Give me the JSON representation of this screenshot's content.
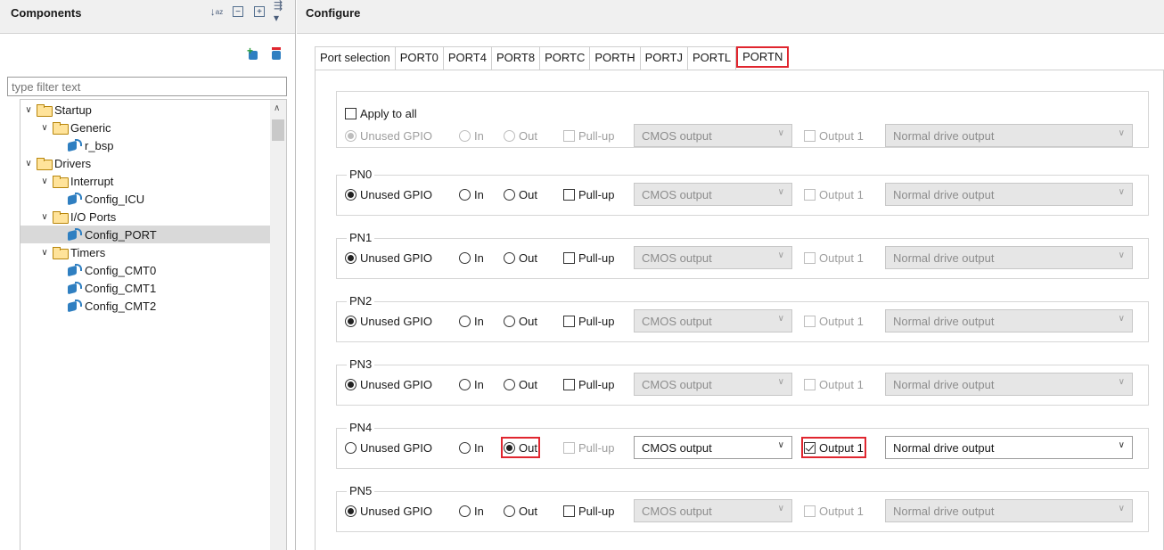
{
  "left_panel": {
    "title": "Components",
    "filter_placeholder": "type filter text",
    "tree": [
      {
        "label": "Startup",
        "depth": 0,
        "kind": "folder"
      },
      {
        "label": "Generic",
        "depth": 1,
        "kind": "folder"
      },
      {
        "label": "r_bsp",
        "depth": 2,
        "kind": "component"
      },
      {
        "label": "Drivers",
        "depth": 0,
        "kind": "folder"
      },
      {
        "label": "Interrupt",
        "depth": 1,
        "kind": "folder"
      },
      {
        "label": "Config_ICU",
        "depth": 2,
        "kind": "component"
      },
      {
        "label": "I/O Ports",
        "depth": 1,
        "kind": "folder"
      },
      {
        "label": "Config_PORT",
        "depth": 2,
        "kind": "component",
        "selected": true
      },
      {
        "label": "Timers",
        "depth": 1,
        "kind": "folder"
      },
      {
        "label": "Config_CMT0",
        "depth": 2,
        "kind": "component"
      },
      {
        "label": "Config_CMT1",
        "depth": 2,
        "kind": "component"
      },
      {
        "label": "Config_CMT2",
        "depth": 2,
        "kind": "component"
      }
    ]
  },
  "right_panel": {
    "title": "Configure",
    "tabs": [
      "Port selection",
      "PORT0",
      "PORT4",
      "PORT8",
      "PORTC",
      "PORTH",
      "PORTJ",
      "PORTL",
      "PORTN"
    ],
    "active_tab": "PORTN",
    "apply_all_label": "Apply to all",
    "labels": {
      "unused": "Unused GPIO",
      "in": "In",
      "out": "Out",
      "pullup": "Pull-up",
      "output1": "Output 1"
    },
    "apply_all_row": {
      "cmos": "CMOS output",
      "drive": "Normal drive output"
    },
    "pins": [
      {
        "name": "PN0",
        "mode": "unused",
        "cmos": "CMOS output",
        "drive": "Normal drive output",
        "output1": false
      },
      {
        "name": "PN1",
        "mode": "unused",
        "cmos": "CMOS output",
        "drive": "Normal drive output",
        "output1": false
      },
      {
        "name": "PN2",
        "mode": "unused",
        "cmos": "CMOS output",
        "drive": "Normal drive output",
        "output1": false
      },
      {
        "name": "PN3",
        "mode": "unused",
        "cmos": "CMOS output",
        "drive": "Normal drive output",
        "output1": false
      },
      {
        "name": "PN4",
        "mode": "out",
        "cmos": "CMOS output",
        "drive": "Normal drive output",
        "output1": true
      },
      {
        "name": "PN5",
        "mode": "unused",
        "cmos": "CMOS output",
        "drive": "Normal drive output",
        "output1": false
      }
    ],
    "highlight_color": "#e0262f"
  }
}
